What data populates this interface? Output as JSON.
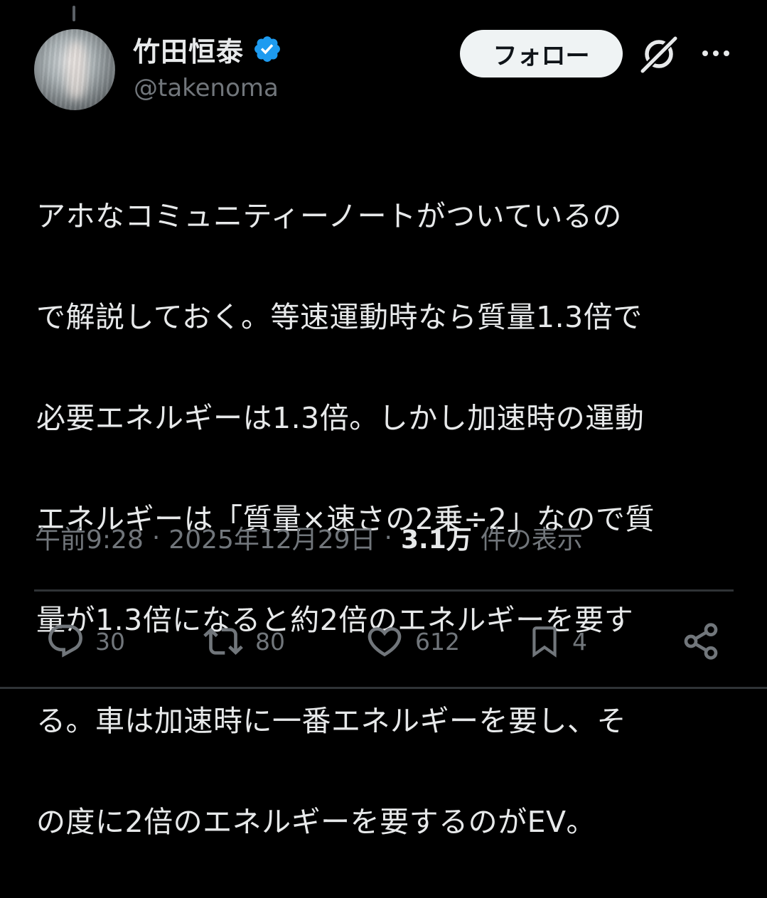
{
  "author": {
    "display_name": "竹田恒泰",
    "handle": "@takenoma",
    "verified": true,
    "avatar_icon": "avatar-photo"
  },
  "header": {
    "follow_label": "フォロー",
    "grok_icon": "grok-icon",
    "more_icon": "more-dots-icon"
  },
  "tweet": {
    "text": "アホなコミュニティーノートがついているので解説しておく。等速運動時なら質量1.3倍で必要エネルギーは1.3倍。しかし加速時の運動エネルギーは「質量×速さの2乗÷2」なので質量が1.3倍になると約2倍のエネルギーを要する。車は加速時に一番エネルギーを要し、その度に2倍のエネルギーを要するのがEV。",
    "lines": [
      "アホなコミュニティーノートがついているの",
      "で解説しておく。等速運動時なら質量1.3倍で",
      "必要エネルギーは1.3倍。しかし加速時の運動",
      "エネルギーは「質量×速さの2乗÷2」なので質",
      "量が1.3倍になると約2倍のエネルギーを要す",
      "る。車は加速時に一番エネルギーを要し、そ",
      "の度に2倍のエネルギーを要するのがEV。"
    ]
  },
  "meta": {
    "time": "午前9:28",
    "date": "2025年12月29日",
    "separator": "·",
    "views_count": "3.1万",
    "views_label": "件の表示"
  },
  "actions": {
    "reply_count": "30",
    "repost_count": "80",
    "like_count": "612",
    "bookmark_count": "4"
  },
  "colors": {
    "background": "#000000",
    "text_primary": "#e7e9ea",
    "text_secondary": "#71767b",
    "verified_blue": "#1d9bf0",
    "divider": "#2f3336",
    "follow_bg": "#eff3f4"
  }
}
